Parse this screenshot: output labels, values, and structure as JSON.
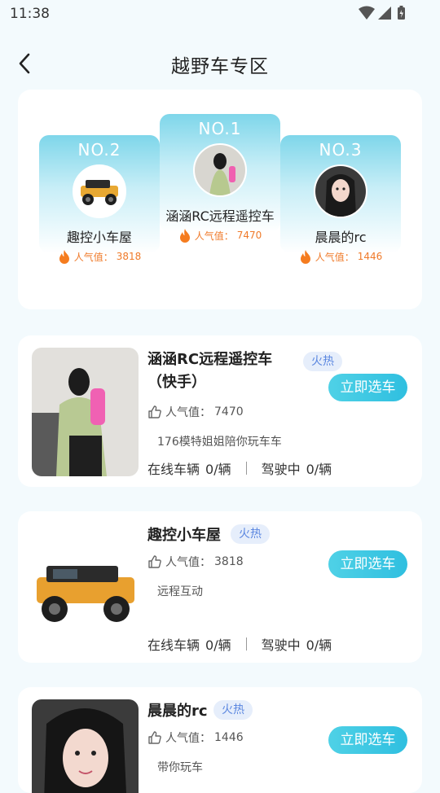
{
  "status": {
    "time": "11:38"
  },
  "header": {
    "title": "越野车专区"
  },
  "podium": [
    {
      "rank": "NO.2",
      "name": "趣控小车屋",
      "pop_label": "人气值：",
      "pop": "3818"
    },
    {
      "rank": "NO.1",
      "name": "涵涵RC远程遥控车",
      "pop_label": "人气值：",
      "pop": "7470"
    },
    {
      "rank": "NO.3",
      "name": "晨晨的rc",
      "pop_label": "人气值：",
      "pop": "1446"
    }
  ],
  "shops": [
    {
      "name_line1": "涵涵RC远程遥控车",
      "name_line2": "（快手）",
      "badge": "火热",
      "button": "立即选车",
      "pop_label": "人气值：",
      "pop": "7470",
      "desc": "176模特姐姐陪你玩车车",
      "online_label": "在线车辆",
      "online": "0/辆",
      "driving_label": "驾驶中",
      "driving": "0/辆"
    },
    {
      "name_line1": "趣控小车屋",
      "badge": "火热",
      "button": "立即选车",
      "pop_label": "人气值：",
      "pop": "3818",
      "desc": "远程互动",
      "online_label": "在线车辆",
      "online": "0/辆",
      "driving_label": "驾驶中",
      "driving": "0/辆"
    },
    {
      "name_line1": "晨晨的rc",
      "badge": "火热",
      "button": "立即选车",
      "pop_label": "人气值：",
      "pop": "1446",
      "desc": "带你玩车"
    }
  ],
  "colors": {
    "accent": "#2fbfe0",
    "popularity": "#ef7a2a",
    "badge_text": "#5b87e0",
    "background": "#f3fafd"
  },
  "icons": [
    "wifi-icon",
    "signal-icon",
    "battery-icon",
    "back-chevron-icon",
    "fire-icon",
    "thumbs-up-icon"
  ]
}
